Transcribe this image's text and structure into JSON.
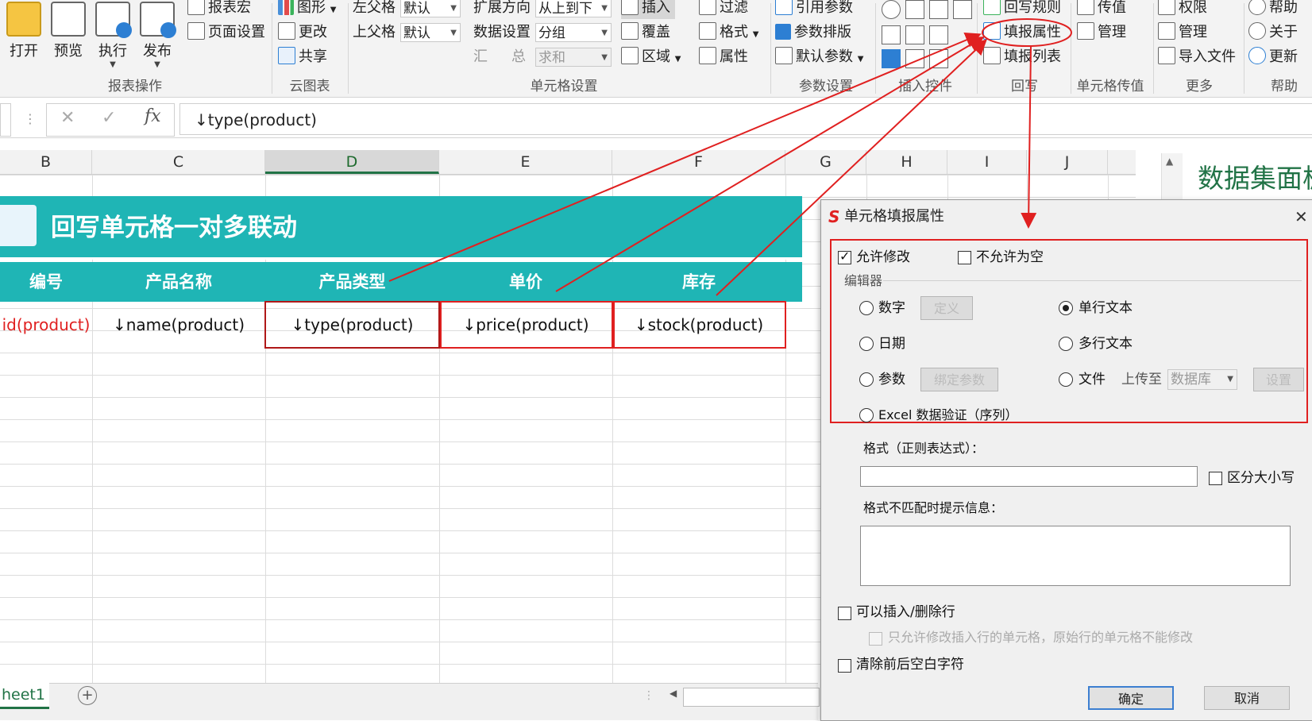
{
  "ribbon": {
    "report_ops": {
      "open": "打开",
      "preview": "预览",
      "execute": "执行",
      "publish": "发布",
      "macro": "报表宏",
      "page_setup": "页面设置",
      "group_label": "报表操作"
    },
    "cloud_chart": {
      "chart": "图形",
      "modify": "更改",
      "share": "共享",
      "group_label": "云图表"
    },
    "cell_settings": {
      "left_parent": "左父格",
      "left_parent_value": "默认",
      "top_parent": "上父格",
      "top_parent_value": "默认",
      "expand_dir": "扩展方向",
      "expand_dir_value": "从上到下",
      "data_setting": "数据设置",
      "data_setting_value": "分组",
      "summary_a": "汇",
      "summary_b": "总",
      "summary_value": "求和",
      "insert": "插入",
      "cover": "覆盖",
      "area": "区域",
      "filter": "过滤",
      "format": "格式",
      "attribute": "属性",
      "group_label": "单元格设置"
    },
    "param_settings": {
      "ref_param": "引用参数",
      "param_layout": "参数排版",
      "default_param": "默认参数",
      "group_label": "参数设置"
    },
    "insert_controls": {
      "group_label": "插入控件"
    },
    "writeback": {
      "rules": "回写规则",
      "fill_attr": "填报属性",
      "fill_list": "填报列表",
      "group_label": "回写"
    },
    "cell_pass": {
      "pass": "传值",
      "manage": "管理",
      "group_label": "单元格传值"
    },
    "more": {
      "permission": "权限",
      "manage": "管理",
      "import_file": "导入文件",
      "group_label": "更多"
    },
    "help": {
      "help": "帮助",
      "about": "关于",
      "update": "更新",
      "group_label": "帮助"
    }
  },
  "formula_bar": {
    "cancel": "✕",
    "confirm": "✓",
    "fx": "fx",
    "value": "↓type(product)"
  },
  "sheet": {
    "columns": [
      "B",
      "C",
      "D",
      "E",
      "F",
      "G",
      "H",
      "I",
      "J"
    ],
    "banner_title": "回写单元格一对多联动",
    "headers": [
      "编号",
      "产品名称",
      "产品类型",
      "单价",
      "库存"
    ],
    "row": [
      "id(product)",
      "↓name(product)",
      "↓type(product)",
      "↓price(product)",
      "↓stock(product)"
    ],
    "tab": "heet1",
    "add_sheet": "+"
  },
  "side_pane": {
    "title": "数据集面板"
  },
  "dialog": {
    "title": "单元格填报属性",
    "logo": "S",
    "close": "✕",
    "allow_modify": "允许修改",
    "not_null": "不允许为空",
    "editor_label": "编辑器",
    "number": "数字",
    "define": "定义",
    "date": "日期",
    "param": "参数",
    "bind_param": "绑定参数",
    "single_text": "单行文本",
    "multi_text": "多行文本",
    "file": "文件",
    "upload_to": "上传至",
    "upload_target": "数据库",
    "settings": "设置",
    "excel_validation": "Excel 数据验证（序列）",
    "format_label": "格式（正则表达式）：",
    "case_sensitive": "区分大小写",
    "mismatch_label": "格式不匹配时提示信息：",
    "insert_delete": "可以插入/删除行",
    "only_inserted": "只允许修改插入行的单元格，原始行的单元格不能修改",
    "trim": "清除前后空白字符",
    "ok": "确定",
    "cancel": "取消"
  },
  "colors": {
    "accent": "#1fb5b5",
    "annotation": "#e02020",
    "excel_green": "#217346"
  }
}
